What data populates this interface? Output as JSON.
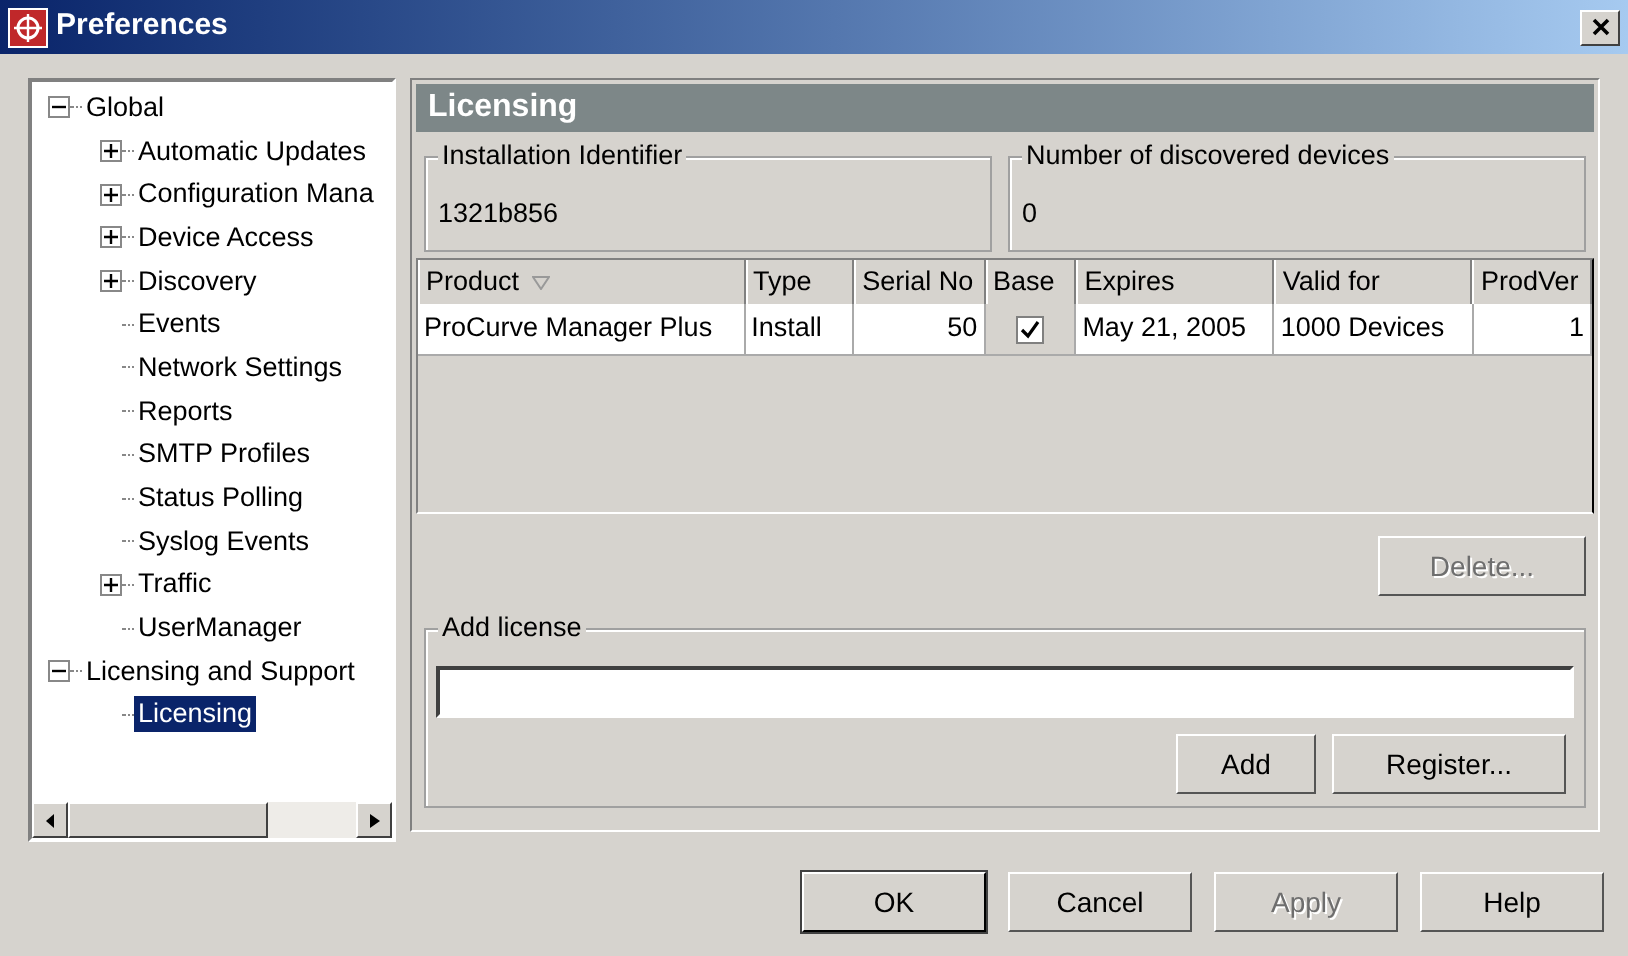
{
  "window": {
    "title": "Preferences"
  },
  "tree": [
    {
      "label": "Global",
      "kind": "node",
      "expanded": true,
      "selected": false,
      "children": [
        {
          "label": "Automatic Updates",
          "kind": "node",
          "expanded": false,
          "selected": false
        },
        {
          "label": "Configuration Mana",
          "kind": "node",
          "expanded": false,
          "selected": false
        },
        {
          "label": "Device Access",
          "kind": "node",
          "expanded": false,
          "selected": false
        },
        {
          "label": "Discovery",
          "kind": "node",
          "expanded": false,
          "selected": false
        },
        {
          "label": "Events",
          "kind": "leaf",
          "selected": false
        },
        {
          "label": "Network Settings",
          "kind": "leaf",
          "selected": false
        },
        {
          "label": "Reports",
          "kind": "leaf",
          "selected": false
        },
        {
          "label": "SMTP Profiles",
          "kind": "leaf",
          "selected": false
        },
        {
          "label": "Status Polling",
          "kind": "leaf",
          "selected": false
        },
        {
          "label": "Syslog Events",
          "kind": "leaf",
          "selected": false
        },
        {
          "label": "Traffic",
          "kind": "node",
          "expanded": false,
          "selected": false
        },
        {
          "label": "UserManager",
          "kind": "leaf",
          "selected": false
        }
      ]
    },
    {
      "label": "Licensing and Support",
      "kind": "node",
      "expanded": true,
      "selected": false,
      "children": [
        {
          "label": "Licensing",
          "kind": "leaf",
          "selected": true
        }
      ]
    }
  ],
  "panel": {
    "title": "Licensing",
    "installation_identifier": {
      "label": "Installation Identifier",
      "value": "1321b856"
    },
    "discovered_devices": {
      "label": "Number of discovered devices",
      "value": "0"
    },
    "table": {
      "columns": [
        {
          "label": "Product",
          "sorted": true
        },
        {
          "label": "Type",
          "sorted": false
        },
        {
          "label": "Serial No",
          "sorted": false
        },
        {
          "label": "Base",
          "sorted": false
        },
        {
          "label": "Expires",
          "sorted": false
        },
        {
          "label": "Valid for",
          "sorted": false
        },
        {
          "label": "ProdVer",
          "sorted": false
        }
      ],
      "rows": [
        {
          "product": "ProCurve Manager Plus",
          "type": "Install",
          "serial_no": "50",
          "base": true,
          "expires": "May 21, 2005",
          "valid_for": "1000 Devices",
          "prodver": "1"
        }
      ]
    },
    "delete_button": {
      "label": "Delete...",
      "disabled": true
    },
    "add_license": {
      "label": "Add license",
      "buttons": [
        {
          "label": "Add",
          "disabled": false
        },
        {
          "label": "Register...",
          "disabled": false
        }
      ]
    }
  },
  "buttons": [
    {
      "label": "OK",
      "disabled": false,
      "default": true
    },
    {
      "label": "Cancel",
      "disabled": false,
      "default": false
    },
    {
      "label": "Apply",
      "disabled": true,
      "default": false
    },
    {
      "label": "Help",
      "disabled": false,
      "default": false
    }
  ]
}
